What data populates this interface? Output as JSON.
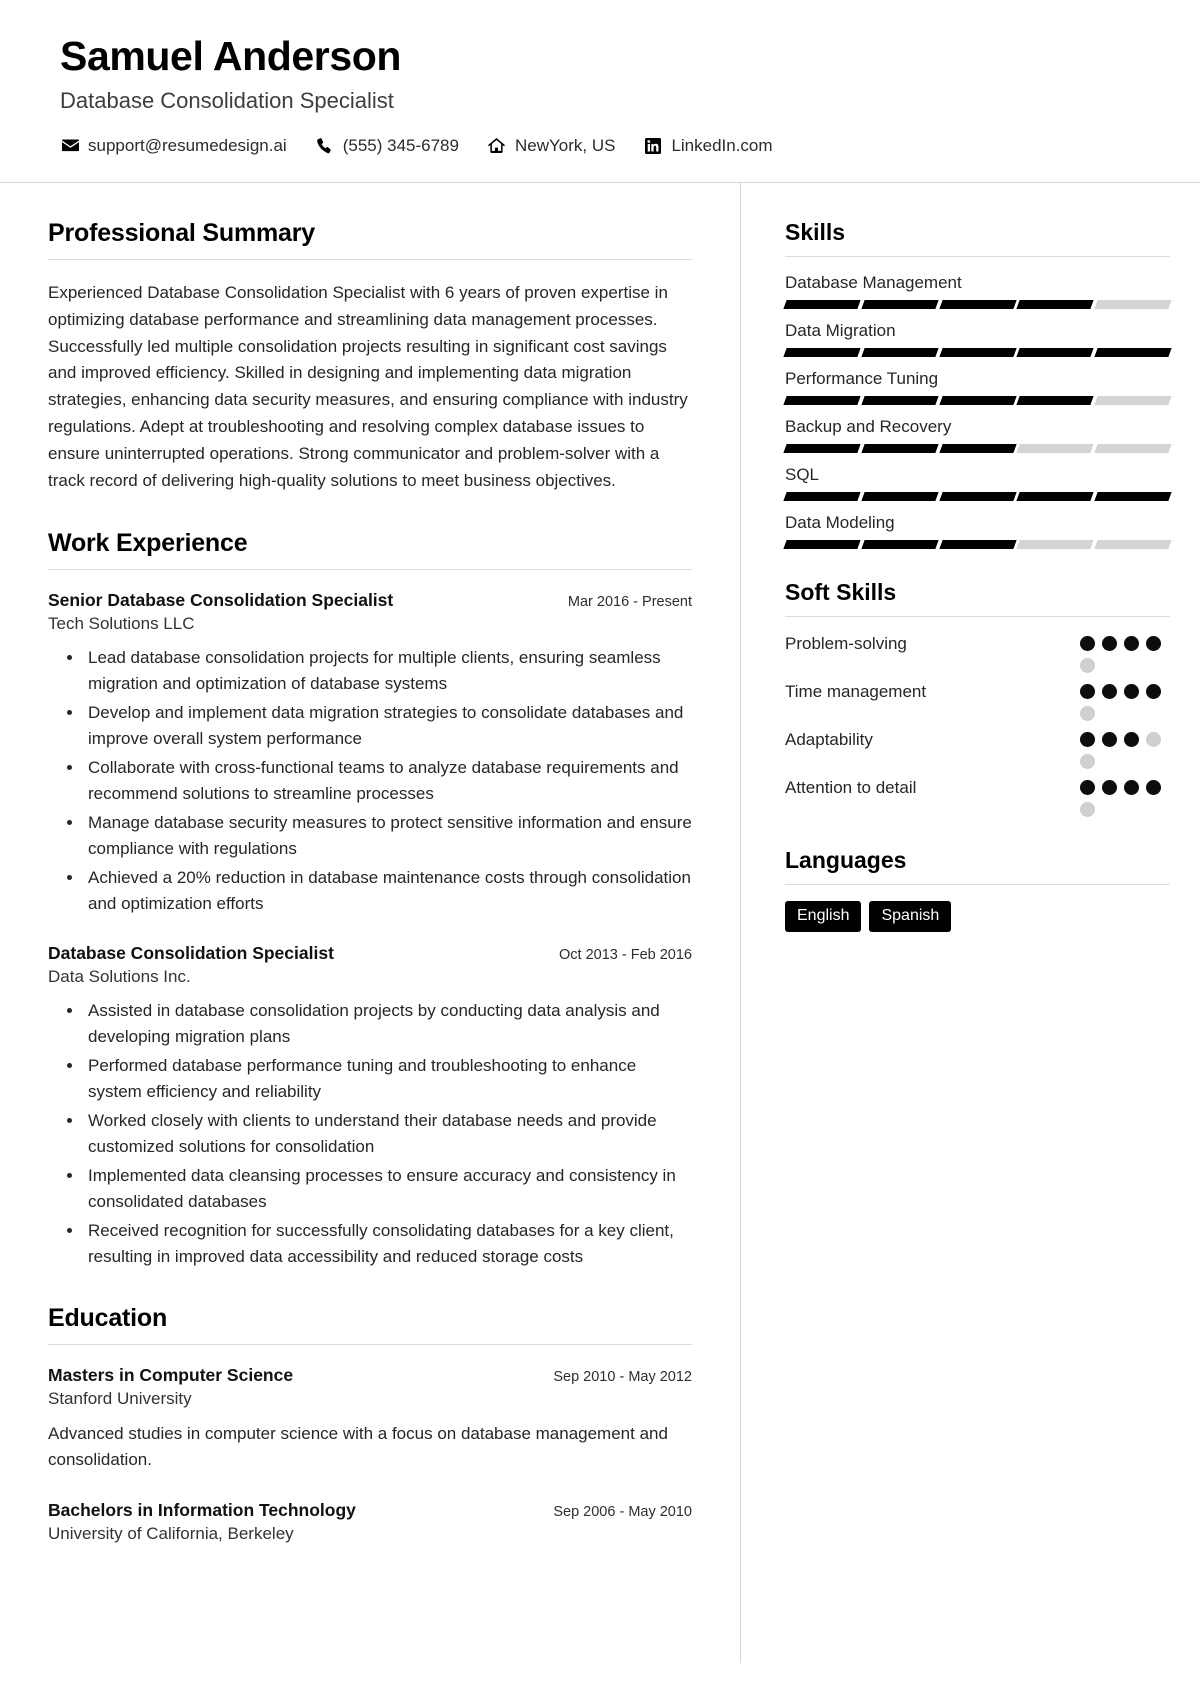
{
  "header": {
    "name": "Samuel Anderson",
    "job_title": "Database Consolidation Specialist",
    "contacts": [
      {
        "icon": "envelope-icon",
        "label": "support@resumedesign.ai"
      },
      {
        "icon": "phone-icon",
        "label": "(555) 345-6789"
      },
      {
        "icon": "home-icon",
        "label": "NewYork, US"
      },
      {
        "icon": "linkedin-icon",
        "label": "LinkedIn.com"
      }
    ]
  },
  "summary": {
    "title": "Professional Summary",
    "text": "Experienced Database Consolidation Specialist with 6 years of proven expertise in optimizing database performance and streamlining data management processes. Successfully led multiple consolidation projects resulting in significant cost savings and improved efficiency. Skilled in designing and implementing data migration strategies, enhancing data security measures, and ensuring compliance with industry regulations. Adept at troubleshooting and resolving complex database issues to ensure uninterrupted operations. Strong communicator and problem-solver with a track record of delivering high-quality solutions to meet business objectives."
  },
  "work": {
    "title": "Work Experience",
    "entries": [
      {
        "role": "Senior Database Consolidation Specialist",
        "date": "Mar 2016 - Present",
        "org": "Tech Solutions LLC",
        "bullets": [
          "Lead database consolidation projects for multiple clients, ensuring seamless migration and optimization of database systems",
          "Develop and implement data migration strategies to consolidate databases and improve overall system performance",
          "Collaborate with cross-functional teams to analyze database requirements and recommend solutions to streamline processes",
          "Manage database security measures to protect sensitive information and ensure compliance with regulations",
          "Achieved a 20% reduction in database maintenance costs through consolidation and optimization efforts"
        ]
      },
      {
        "role": "Database Consolidation Specialist",
        "date": "Oct 2013 - Feb 2016",
        "org": "Data Solutions Inc.",
        "bullets": [
          "Assisted in database consolidation projects by conducting data analysis and developing migration plans",
          "Performed database performance tuning and troubleshooting to enhance system efficiency and reliability",
          "Worked closely with clients to understand their database needs and provide customized solutions for consolidation",
          "Implemented data cleansing processes to ensure accuracy and consistency in consolidated databases",
          "Received recognition for successfully consolidating databases for a key client, resulting in improved data accessibility and reduced storage costs"
        ]
      }
    ]
  },
  "education": {
    "title": "Education",
    "entries": [
      {
        "degree": "Masters in Computer Science",
        "date": "Sep 2010 - May 2012",
        "school": "Stanford University",
        "description": "Advanced studies in computer science with a focus on database management and consolidation."
      },
      {
        "degree": "Bachelors in Information Technology",
        "date": "Sep 2006 - May 2010",
        "school": "University of California, Berkeley",
        "description": ""
      }
    ]
  },
  "skills": {
    "title": "Skills",
    "max_level": 5,
    "items": [
      {
        "name": "Database Management",
        "level": 4
      },
      {
        "name": "Data Migration",
        "level": 5
      },
      {
        "name": "Performance Tuning",
        "level": 4
      },
      {
        "name": "Backup and Recovery",
        "level": 3
      },
      {
        "name": "SQL",
        "level": 5
      },
      {
        "name": "Data Modeling",
        "level": 3
      }
    ]
  },
  "soft_skills": {
    "title": "Soft Skills",
    "max_level": 5,
    "items": [
      {
        "name": "Problem-solving",
        "level": 4
      },
      {
        "name": "Time management",
        "level": 4
      },
      {
        "name": "Adaptability",
        "level": 3
      },
      {
        "name": "Attention to detail",
        "level": 4
      }
    ]
  },
  "languages": {
    "title": "Languages",
    "items": [
      "English",
      "Spanish"
    ]
  },
  "colors": {
    "accent": "#000000",
    "muted_bar": "#d4d4d4",
    "muted_dot": "#cfcfcf",
    "rule": "#dcdcdc",
    "text": "#262626"
  }
}
